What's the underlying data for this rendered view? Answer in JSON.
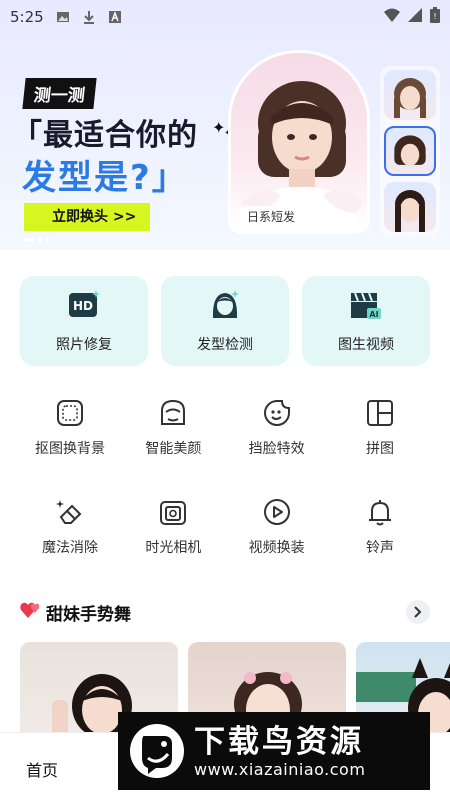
{
  "status_bar": {
    "time": "5:25",
    "icons": [
      "image-icon",
      "download-icon",
      "a-badge-icon",
      "wifi-icon",
      "signal-icon",
      "battery-icon"
    ]
  },
  "banner": {
    "tag": "测一测",
    "headline_line1": "「最适合你的",
    "headline_line2": "发型是?」",
    "cta": "立即换头 >>",
    "portrait_label": "日系短发",
    "accent_color": "#2c7be5",
    "cta_color": "#d7f51f"
  },
  "feature_cards": [
    {
      "label": "照片修复",
      "icon": "hd-icon"
    },
    {
      "label": "发型检测",
      "icon": "hairstyle-icon"
    },
    {
      "label": "图生视频",
      "icon": "ai-video-icon"
    }
  ],
  "tools_row1": [
    {
      "label": "抠图换背景",
      "icon": "cutout-icon"
    },
    {
      "label": "智能美颜",
      "icon": "beauty-icon"
    },
    {
      "label": "挡脸特效",
      "icon": "sticker-face-icon"
    },
    {
      "label": "拼图",
      "icon": "collage-icon"
    }
  ],
  "tools_row2": [
    {
      "label": "魔法消除",
      "icon": "eraser-icon"
    },
    {
      "label": "时光相机",
      "icon": "camera-icon"
    },
    {
      "label": "视频换装",
      "icon": "video-play-icon"
    },
    {
      "label": "铃声",
      "icon": "bell-icon"
    }
  ],
  "section": {
    "title": "甜妹手势舞",
    "icon": "hearts-icon"
  },
  "bottom_nav": {
    "home_label": "首页"
  },
  "watermark": {
    "title": "下载鸟资源",
    "url": "www.xiazainiao.com"
  }
}
